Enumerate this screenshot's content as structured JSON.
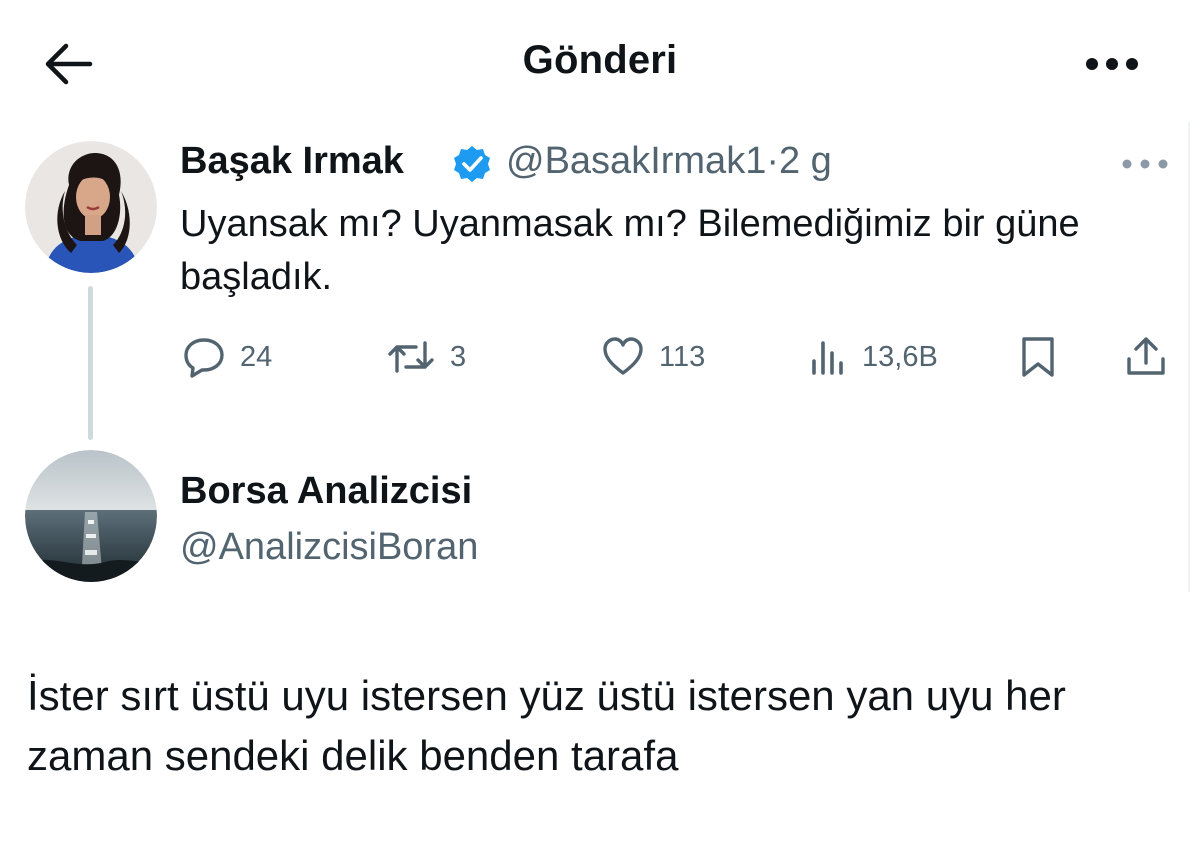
{
  "header": {
    "title": "Gönderi",
    "back_icon": "arrow-left-icon",
    "more_icon": "more-horizontal-icon"
  },
  "tweet": {
    "author_name": "Başak Irmak",
    "verified": true,
    "handle": "@BasakIrmak1",
    "separator": "·",
    "time": "2 g",
    "text": "Uyansak mı? Uyanmasak mı? Bilemediğimiz bir güne başladık.",
    "actions": {
      "replies": "24",
      "retweets": "3",
      "likes": "113",
      "views": "13,6B"
    }
  },
  "reply": {
    "author_name": "Borsa Analizcisi",
    "handle": "@AnalizcisiBoran",
    "text": "İster sırt üstü uyu istersen yüz üstü istersen yan uyu her zaman sendeki delik benden tarafa"
  },
  "colors": {
    "text": "#0f1419",
    "secondary": "#536471",
    "verified": "#1d9bf0",
    "thread_line": "#cfd9de"
  }
}
